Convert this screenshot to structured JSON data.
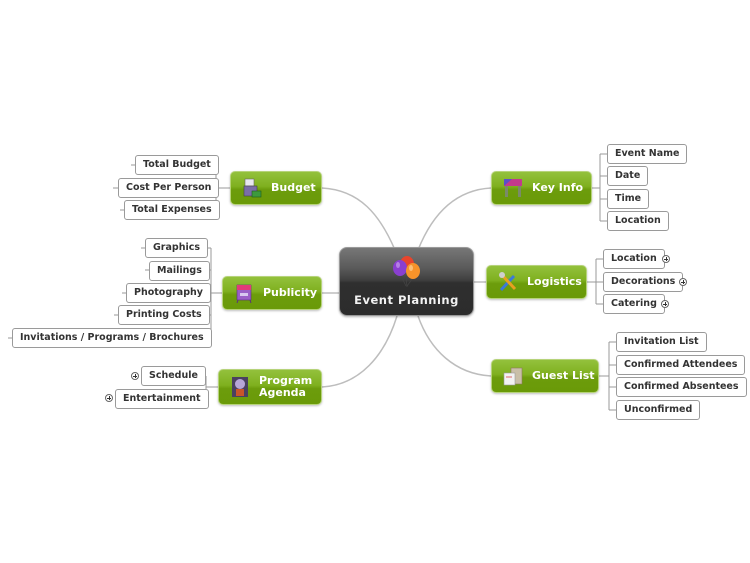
{
  "central": {
    "label": "Event Planning",
    "icon": "balloons-icon"
  },
  "topics": {
    "budget": {
      "label": "Budget",
      "icon": "cash-register-icon",
      "children": [
        "Total Budget",
        "Cost Per Person",
        "Total Expenses"
      ]
    },
    "publicity": {
      "label": "Publicity",
      "icon": "sign-board-icon",
      "children": [
        "Graphics",
        "Mailings",
        "Photography",
        "Printing Costs",
        "Invitations / Programs / Brochures"
      ]
    },
    "program_agenda": {
      "label_line1": "Program",
      "label_line2": "Agenda",
      "icon": "speaker-podium-icon",
      "children": [
        "Schedule",
        "Entertainment"
      ],
      "collapsed": [
        true,
        true
      ]
    },
    "key_info": {
      "label": "Key Info",
      "icon": "stage-curtain-icon",
      "children": [
        "Event Name",
        "Date",
        "Time",
        "Location"
      ]
    },
    "logistics": {
      "label": "Logistics",
      "icon": "tools-icon",
      "children": [
        "Location",
        "Decorations",
        "Catering"
      ],
      "collapsed": [
        true,
        true,
        true
      ]
    },
    "guest_list": {
      "label": "Guest List",
      "icon": "mail-box-icon",
      "children": [
        "Invitation List",
        "Confirmed Attendees",
        "Confirmed Absentees",
        "Unconfirmed"
      ]
    }
  },
  "colors": {
    "topic_green": "#7fb01f",
    "central_dark": "#2f2f2f",
    "connector": "#b8b8b8"
  }
}
